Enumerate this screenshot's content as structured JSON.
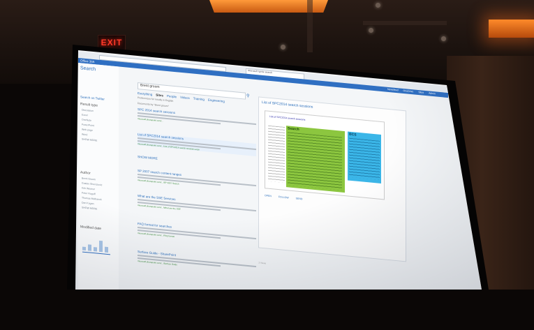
{
  "scene": {
    "exit_sign": "EXIT",
    "light_color": "#ff9a3a"
  },
  "screen": {
    "browser": {
      "tab_label": "Microsoft Ignite search"
    },
    "suite_bar": {
      "logo": "Office 365",
      "nav": [
        "Newsfeed",
        "OneDrive",
        "Sites",
        "Admin"
      ]
    },
    "left_nav": {
      "title": "Search",
      "scope_link": "Search on Twitter",
      "result_type": {
        "heading": "Result type",
        "items": [
          "Discussion",
          "Excel",
          "OneNote",
          "PowerPoint",
          "Web page",
          "Word",
          "SHOW MORE"
        ]
      },
      "author": {
        "heading": "Author",
        "items": [
          "Brent Groom",
          "Gustav Sherazovic",
          "Kirk Weaver",
          "Peter Rogoff",
          "Thomas Molbaeck",
          "Dan Kogan",
          "SHOW MORE"
        ]
      },
      "modified": {
        "heading": "Modified date",
        "bars": [
          0.3,
          0.55,
          0.35,
          1.0,
          0.5
        ]
      }
    },
    "main": {
      "query": "Brent groom",
      "verticals": [
        "Everything",
        "Sites",
        "People",
        "Videos",
        "Training",
        "Engineering"
      ],
      "active_vertical": "Sites",
      "preferences": "Preferences for results in English",
      "count": "Documents by \"Brent groom\"",
      "results": [
        {
          "title": "SPC 2014 search sessions",
          "url": "microsoft.sharepoint.com/...",
          "meta": ""
        },
        {
          "title": "List of SPC2014 search sessions",
          "url": "microsoft.sharepoint.com/.../List of SPC2014 search sessions.aspx",
          "meta": "",
          "highlight": true
        },
        {
          "title": "SHOW MORE",
          "url": "",
          "meta": ""
        },
        {
          "title": "SP 2007 search content ranges",
          "url": "microsoft.sharepoint.com/.../SP 2007 Search",
          "meta": "3 Views"
        },
        {
          "title": "What are the SSE Services",
          "url": "microsoft.sharepoint.com/.../What are the SSE",
          "meta": "6 Views"
        },
        {
          "title": "FAQ format for searches",
          "url": "microsoft.sharepoint.com/.../FAQ format",
          "meta": "3 Views"
        },
        {
          "title": "Surface Guide - SharePoint",
          "url": "microsoft.sharepoint.com/.../Surface Guide",
          "meta": "2 Views"
        }
      ]
    },
    "hover_panel": {
      "title": "List of SPC2014 search sessions",
      "thumb_header": "List of SPC2014 search sessions",
      "green_label": "Search",
      "blue_label": "BCS",
      "actions": [
        "OPEN",
        "FOLLOW",
        "SEND"
      ]
    },
    "feedback": "Feedback"
  }
}
